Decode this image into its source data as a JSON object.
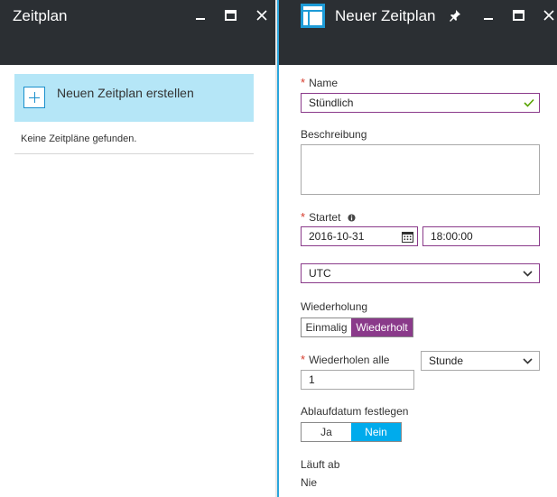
{
  "left_blade": {
    "title": "Zeitplan",
    "create_label": "Neuen Zeitplan erstellen",
    "empty_message": "Keine Zeitpläne gefunden."
  },
  "right_blade": {
    "title": "Neuer Zeitplan",
    "name": {
      "label": "Name",
      "value": "Stündlich"
    },
    "description": {
      "label": "Beschreibung",
      "value": ""
    },
    "start": {
      "label": "Startet",
      "date": "2016-10-31",
      "time": "18:00:00"
    },
    "timezone": {
      "value": "UTC"
    },
    "recurrence": {
      "label": "Wiederholung",
      "options": [
        "Einmalig",
        "Wiederholt"
      ],
      "selected": "Wiederholt"
    },
    "repeat_every": {
      "label": "Wiederholen alle",
      "value": "1",
      "unit": "Stunde"
    },
    "expiry": {
      "label": "Ablaufdatum festlegen",
      "options": [
        "Ja",
        "Nein"
      ],
      "selected": "Nein"
    },
    "expires": {
      "label": "Läuft ab",
      "value": "Nie"
    }
  },
  "colors": {
    "header_bg": "#2b2f33",
    "accent_blue": "#00abec",
    "tile_bg": "#b5e6f7",
    "selected_purple": "#8a3a8a",
    "required_red": "#d63b2b",
    "valid_green": "#57a300"
  }
}
